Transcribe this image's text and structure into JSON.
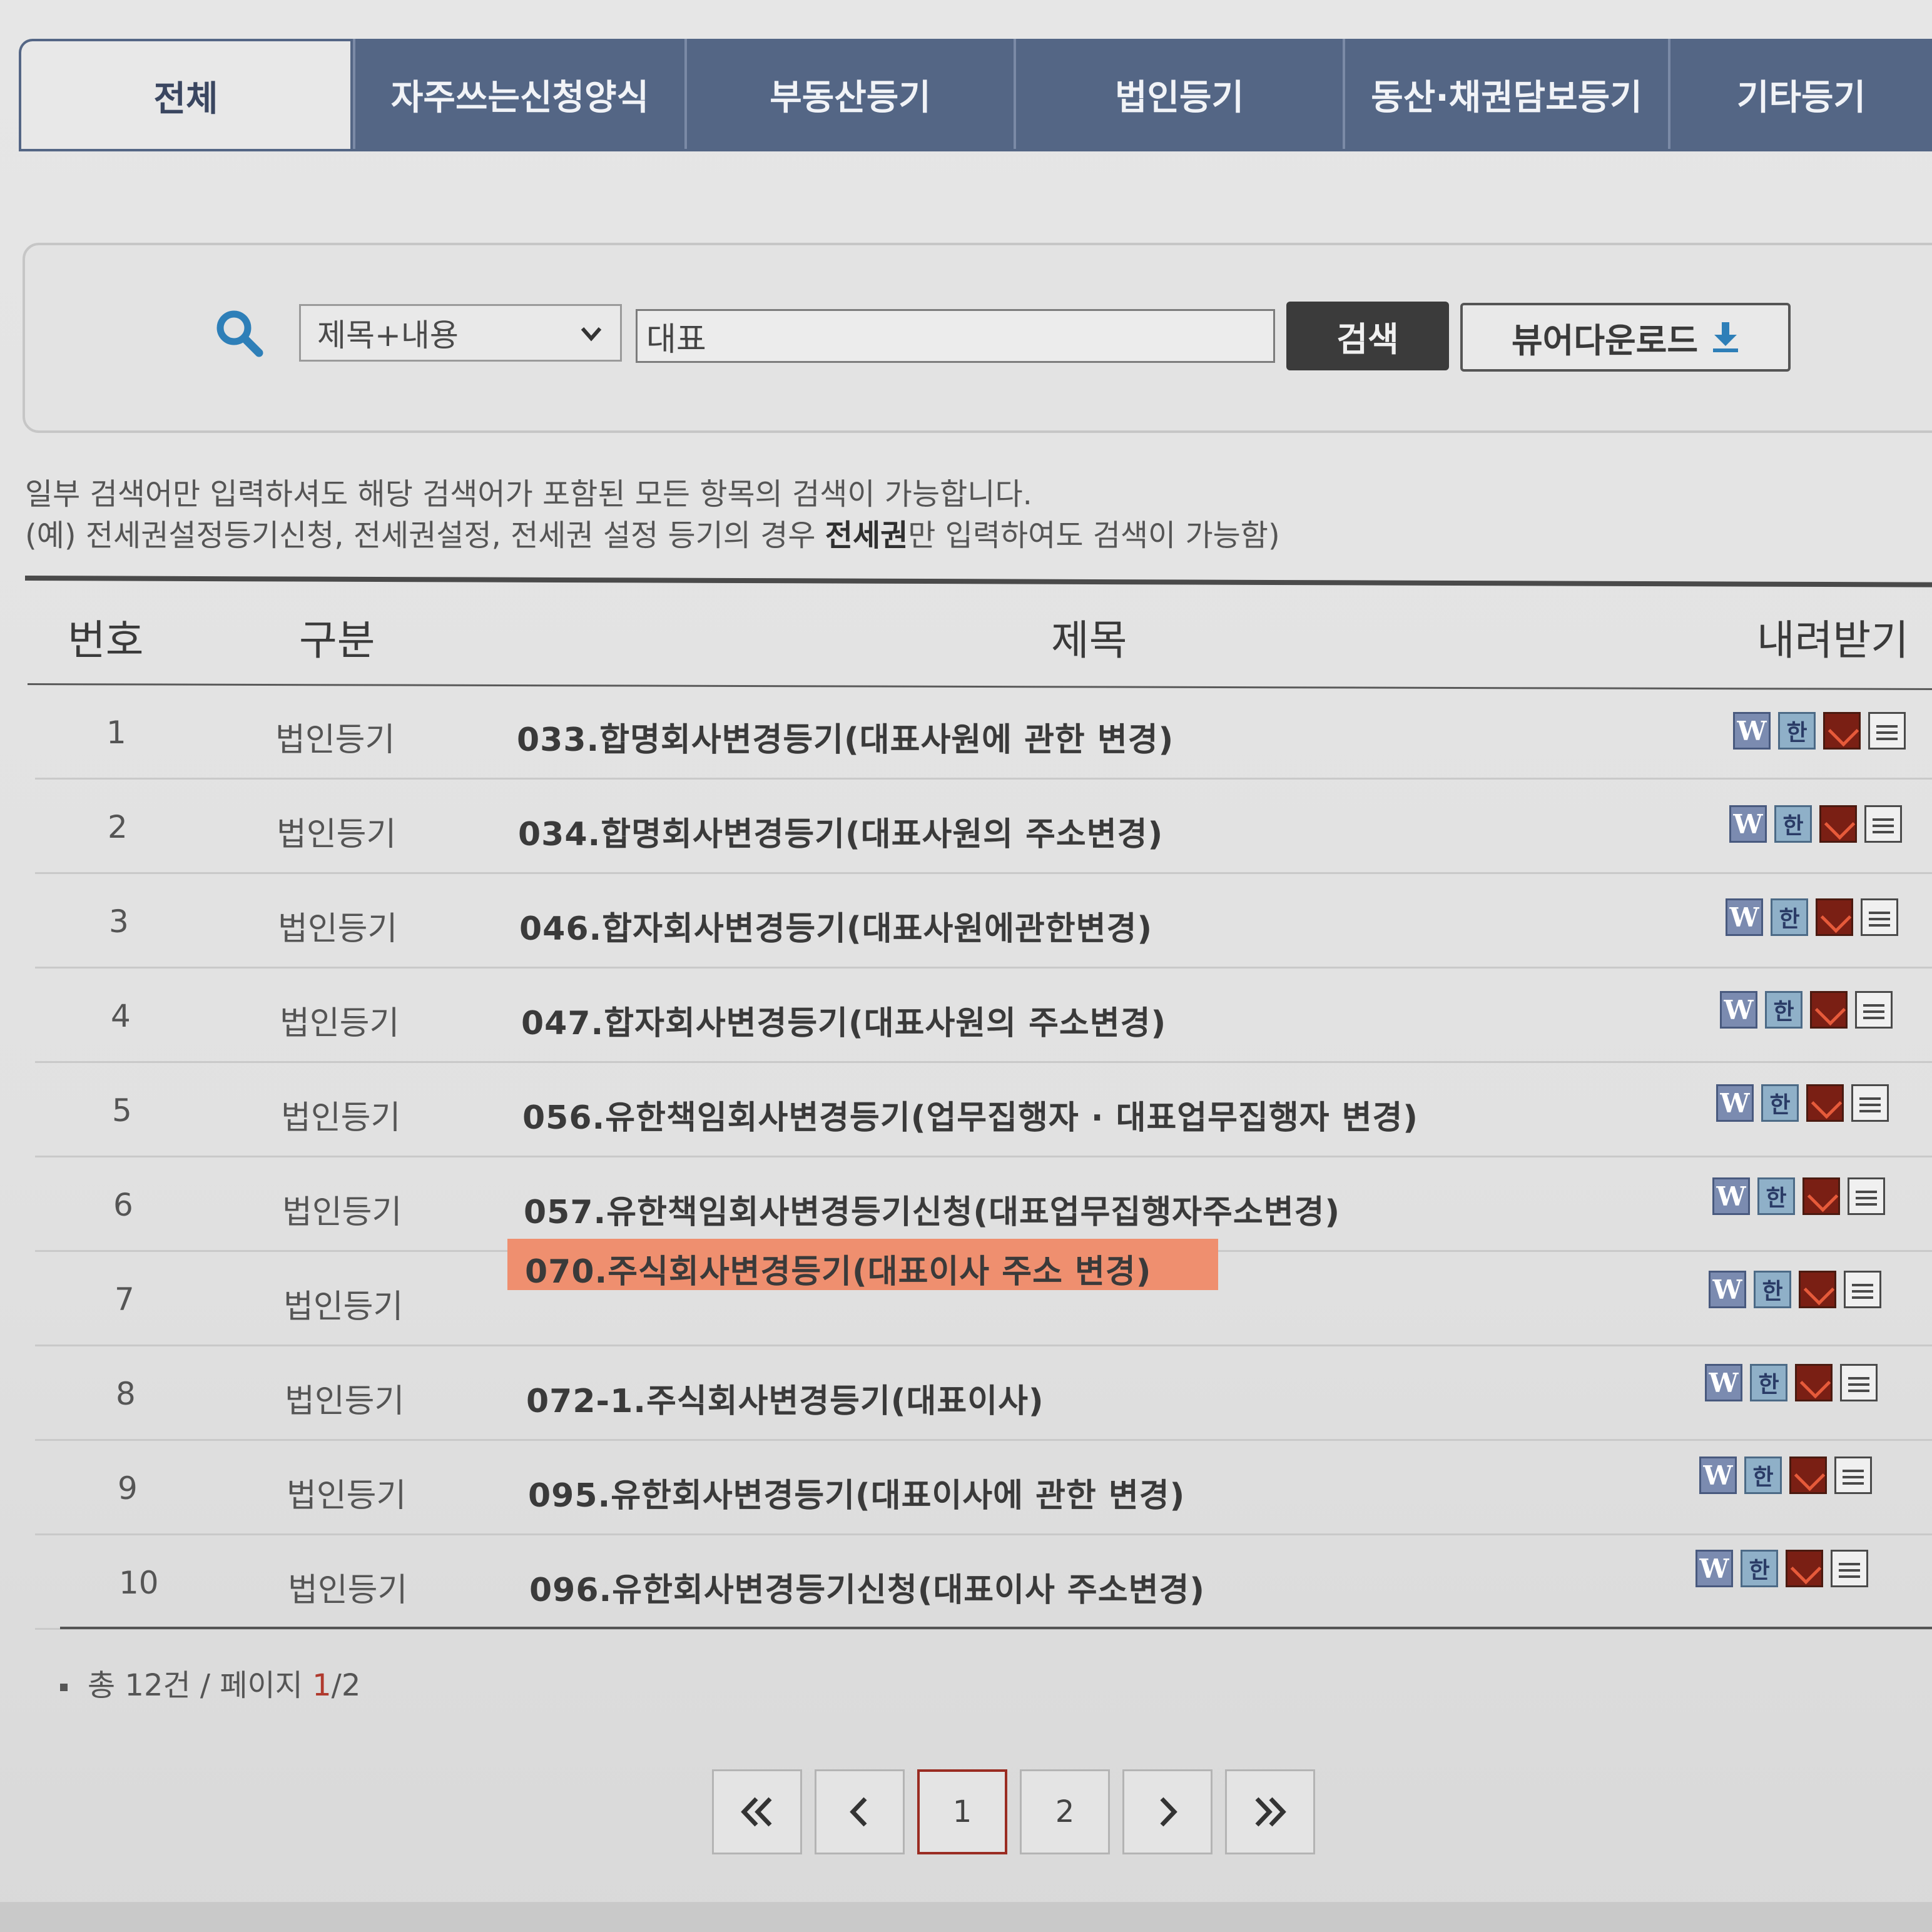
{
  "tabs": [
    {
      "label": "전체",
      "active": true
    },
    {
      "label": "자주쓰는신청양식",
      "active": false
    },
    {
      "label": "부동산등기",
      "active": false
    },
    {
      "label": "법인등기",
      "active": false
    },
    {
      "label": "동산·채권담보등기",
      "active": false
    },
    {
      "label": "기타등기",
      "active": false
    }
  ],
  "search": {
    "field_selected": "제목+내용",
    "query": "대표",
    "search_button": "검색",
    "viewer_button": "뷰어다운로드"
  },
  "help": {
    "line1": "일부 검색어만 입력하셔도 해당 검색어가 포함된 모든 항목의 검색이 가능합니다.",
    "line2_prefix": "(예) 전세권설정등기신청, 전세권설정, 전세권 설정 등기의 경우 ",
    "line2_bold": "전세권",
    "line2_suffix": "만 입력하여도 검색이 가능함)"
  },
  "table": {
    "headers": {
      "num": "번호",
      "category": "구분",
      "title": "제목",
      "download": "내려받기"
    },
    "rows": [
      {
        "num": "1",
        "category": "법인등기",
        "title": "033.합명회사변경등기(대표사원에 관한 변경)"
      },
      {
        "num": "2",
        "category": "법인등기",
        "title": "034.합명회사변경등기(대표사원의 주소변경)"
      },
      {
        "num": "3",
        "category": "법인등기",
        "title": "046.합자회사변경등기(대표사원에관한변경)"
      },
      {
        "num": "4",
        "category": "법인등기",
        "title": "047.합자회사변경등기(대표사원의 주소변경)"
      },
      {
        "num": "5",
        "category": "법인등기",
        "title": "056.유한책임회사변경등기(업무집행자 · 대표업무집행자 변경)"
      },
      {
        "num": "6",
        "category": "법인등기",
        "title": "057.유한책임회사변경등기신청(대표업무집행자주소변경)"
      },
      {
        "num": "7",
        "category": "법인등기",
        "title": "070.주식회사변경등기(대표이사 주소 변경)",
        "highlighted": true
      },
      {
        "num": "8",
        "category": "법인등기",
        "title": "072-1.주식회사변경등기(대표이사)"
      },
      {
        "num": "9",
        "category": "법인등기",
        "title": "095.유한회사변경등기(대표이사에 관한 변경)"
      },
      {
        "num": "10",
        "category": "법인등기",
        "title": "096.유한회사변경등기신청(대표이사 주소변경)"
      }
    ],
    "download_icons": [
      "word-icon",
      "hwp-icon",
      "pdf-icon",
      "document-icon"
    ],
    "download_icon_glyphs": {
      "word": "W",
      "hwp": "한"
    }
  },
  "summary": {
    "total_label": "총 12건 / 페이지 ",
    "current_page": "1",
    "page_sep": "/",
    "total_pages": "2"
  },
  "pagination": {
    "pages": [
      "1",
      "2"
    ],
    "current": "1"
  },
  "colors": {
    "tab_bg": "#546685",
    "search_button_bg": "#3b3b3b",
    "highlight": "#ef8f6f",
    "current_page_border": "#9a2c22"
  }
}
